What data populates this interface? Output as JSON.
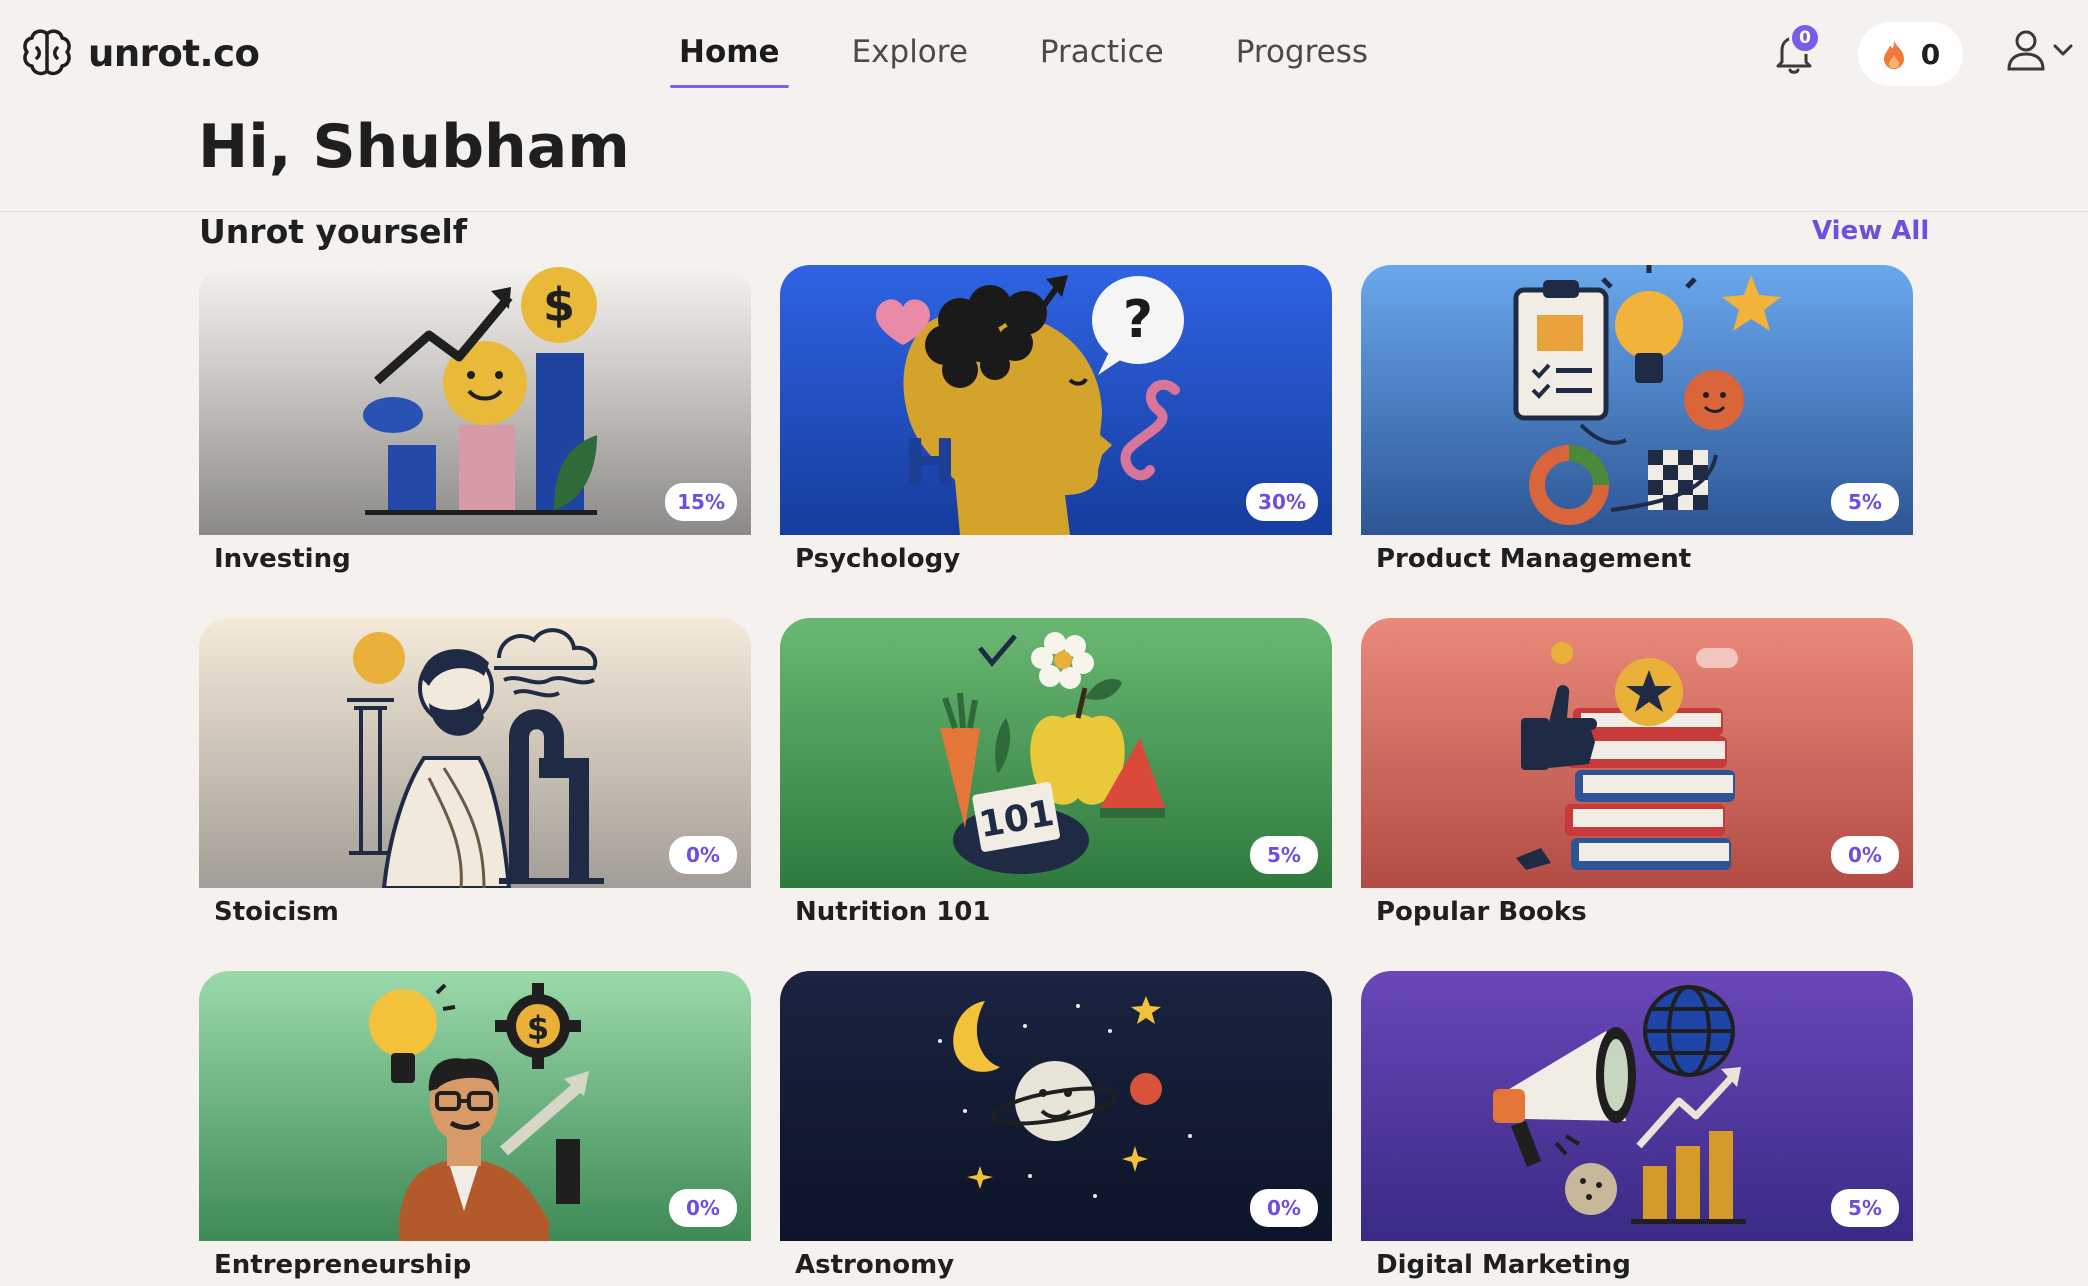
{
  "brand": {
    "name": "unrot.co"
  },
  "nav": {
    "items": [
      {
        "label": "Home",
        "active": true
      },
      {
        "label": "Explore",
        "active": false
      },
      {
        "label": "Practice",
        "active": false
      },
      {
        "label": "Progress",
        "active": false
      }
    ]
  },
  "notifications": {
    "count": "0"
  },
  "streak": {
    "count": "0"
  },
  "greeting": "Hi, Shubham",
  "section": {
    "title": "Unrot yourself",
    "view_all": "View All"
  },
  "courses": [
    {
      "title": "Investing",
      "progress": "15%"
    },
    {
      "title": "Psychology",
      "progress": "30%"
    },
    {
      "title": "Product Management",
      "progress": "5%"
    },
    {
      "title": "Stoicism",
      "progress": "0%"
    },
    {
      "title": "Nutrition 101",
      "progress": "5%"
    },
    {
      "title": "Popular Books",
      "progress": "0%"
    },
    {
      "title": "Entrepreneurship",
      "progress": "0%"
    },
    {
      "title": "Astronomy",
      "progress": "0%"
    },
    {
      "title": "Digital Marketing",
      "progress": "5%"
    }
  ],
  "nutrition_art_label": "101",
  "colors": {
    "accent": "#7b63e6",
    "badge_text": "#6d4fe0",
    "background": "#f4f1ee"
  }
}
